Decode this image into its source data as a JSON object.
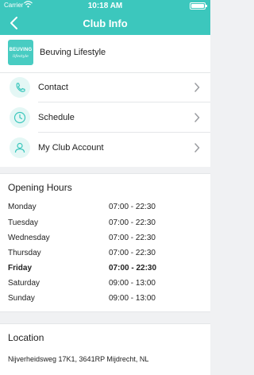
{
  "status": {
    "carrier": "Carrier",
    "time": "10:18 AM"
  },
  "nav": {
    "title": "Club Info"
  },
  "club": {
    "name": "Beuving Lifestyle",
    "logo_line1": "BEUVING",
    "logo_line2": "lifestyle"
  },
  "menu": [
    {
      "label": "Contact",
      "icon": "phone-icon"
    },
    {
      "label": "Schedule",
      "icon": "clock-icon"
    },
    {
      "label": "My Club Account",
      "icon": "user-icon"
    }
  ],
  "opening_hours": {
    "title": "Opening Hours",
    "days": [
      {
        "day": "Monday",
        "hours": "07:00 - 22:30"
      },
      {
        "day": "Tuesday",
        "hours": "07:00 - 22:30"
      },
      {
        "day": "Wednesday",
        "hours": "07:00 - 22:30"
      },
      {
        "day": "Thursday",
        "hours": "07:00 - 22:30"
      },
      {
        "day": "Friday",
        "hours": "07:00 - 22:30"
      },
      {
        "day": "Saturday",
        "hours": "09:00 - 13:00"
      },
      {
        "day": "Sunday",
        "hours": "09:00 - 13:00"
      }
    ],
    "current_day": "Friday"
  },
  "location": {
    "title": "Location",
    "address": "Nijverheidsweg 17K1, 3641RP Mijdrecht, NL"
  },
  "colors": {
    "accent": "#3cc7bd",
    "icon_bg": "#e4f7f5"
  }
}
